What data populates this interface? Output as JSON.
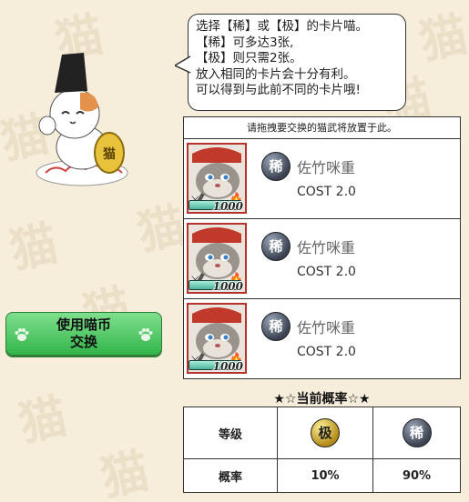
{
  "bubble": {
    "lines": [
      "选择【稀】或【极】的卡片喵。",
      "【稀】可多达3张,",
      "【极】则只需2张。",
      "放入相同的卡片会十分有利。",
      "可以得到与此前不同的卡片哦!"
    ]
  },
  "instruction": "请拖拽要交换的猫武将放置于此。",
  "cards": [
    {
      "name": "佐竹咪重",
      "cost": "COST 2.0",
      "rarity": "稀",
      "power": "1000",
      "hp_fraction": 1.0
    },
    {
      "name": "佐竹咪重",
      "cost": "COST 2.0",
      "rarity": "稀",
      "power": "1000",
      "hp_fraction": 1.0
    },
    {
      "name": "佐竹咪重",
      "cost": "COST 2.0",
      "rarity": "稀",
      "power": "1000",
      "hp_fraction": 1.0
    }
  ],
  "exchange_button": {
    "line1": "使用喵币",
    "line2": "交换"
  },
  "probability": {
    "title": "★☆当前概率☆★",
    "grade_label": "等级",
    "rate_label": "概率",
    "grades": [
      "极",
      "稀"
    ],
    "rates": [
      "10%",
      "90%"
    ]
  },
  "mascot": {
    "coin_text": "猫"
  },
  "icons": [
    "mascot-cat",
    "paw-icon",
    "sword-icon",
    "fire-icon"
  ],
  "colors": {
    "button_green": "#33b54b",
    "portrait_border": "#b7322a",
    "background": "#f6eddb"
  }
}
